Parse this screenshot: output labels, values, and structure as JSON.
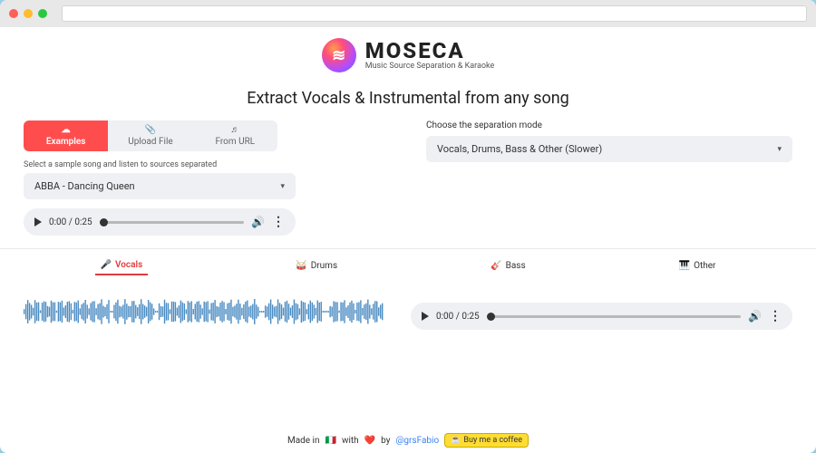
{
  "brand": {
    "name": "MOSECA",
    "tagline": "Music Source Separation & Karaoke"
  },
  "hero": "Extract Vocals & Instrumental from any song",
  "input_tabs": [
    {
      "label": "Examples",
      "icon": "☁",
      "active": true
    },
    {
      "label": "Upload File",
      "icon": "📎",
      "active": false
    },
    {
      "label": "From URL",
      "icon": "♬",
      "active": false
    }
  ],
  "sample_hint": "Select a sample song and listen to sources separated",
  "sample_select": {
    "value": "ABBA - Dancing Queen"
  },
  "mode_label": "Choose the separation mode",
  "mode_select": {
    "value": "Vocals, Drums, Bass & Other (Slower)"
  },
  "player": {
    "current": "0:00",
    "total": "0:25"
  },
  "source_tabs": [
    {
      "label": "Vocals",
      "icon": "🎤",
      "active": true
    },
    {
      "label": "Drums",
      "icon": "🥁",
      "active": false
    },
    {
      "label": "Bass",
      "icon": "🎸",
      "active": false
    },
    {
      "label": "Other",
      "icon": "🎹",
      "active": false
    }
  ],
  "player2": {
    "current": "0:00",
    "total": "0:25"
  },
  "footer": {
    "prefix": "Made in",
    "flag": "🇮🇹",
    "with": "with",
    "heart": "❤️",
    "by": "by",
    "author": "@grsFabio",
    "coffee": "Buy me a coffee"
  }
}
